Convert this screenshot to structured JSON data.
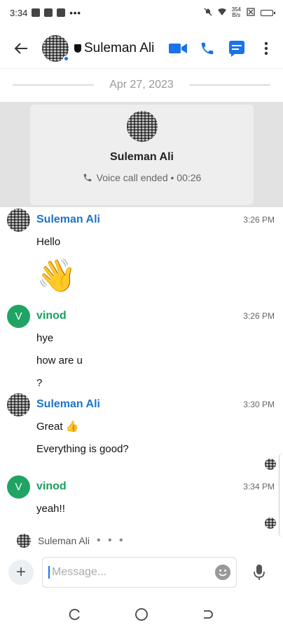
{
  "status_bar": {
    "time": "3:34",
    "dots": "•••",
    "net_speed_top": "354",
    "net_speed_bottom": "B/s"
  },
  "header": {
    "contact_name": "Suleman Ali"
  },
  "date_divider": "Apr 27, 2023",
  "call_card": {
    "name": "Suleman Ali",
    "status": "Voice call ended • 00:26"
  },
  "messages": [
    {
      "sender": "Suleman Ali",
      "time": "3:26 PM",
      "lines": [
        "Hello"
      ],
      "emoji": "👋"
    },
    {
      "sender": "vinod",
      "avatar_letter": "V",
      "time": "3:26 PM",
      "lines": [
        "hye",
        "how are u",
        "?"
      ]
    },
    {
      "sender": "Suleman Ali",
      "time": "3:30 PM",
      "lines": [
        "Great 👍",
        "Everything is good?"
      ]
    },
    {
      "sender": "vinod",
      "avatar_letter": "V",
      "time": "3:34 PM",
      "lines": [
        "yeah!!"
      ]
    }
  ],
  "typing": {
    "name": "Suleman Ali",
    "dots": "• • •"
  },
  "composer": {
    "placeholder": "Message...",
    "add_label": "+"
  },
  "colors": {
    "accent": "#1a73e8",
    "sender_blue": "#1e74c9",
    "sender_green": "#17a05d"
  }
}
